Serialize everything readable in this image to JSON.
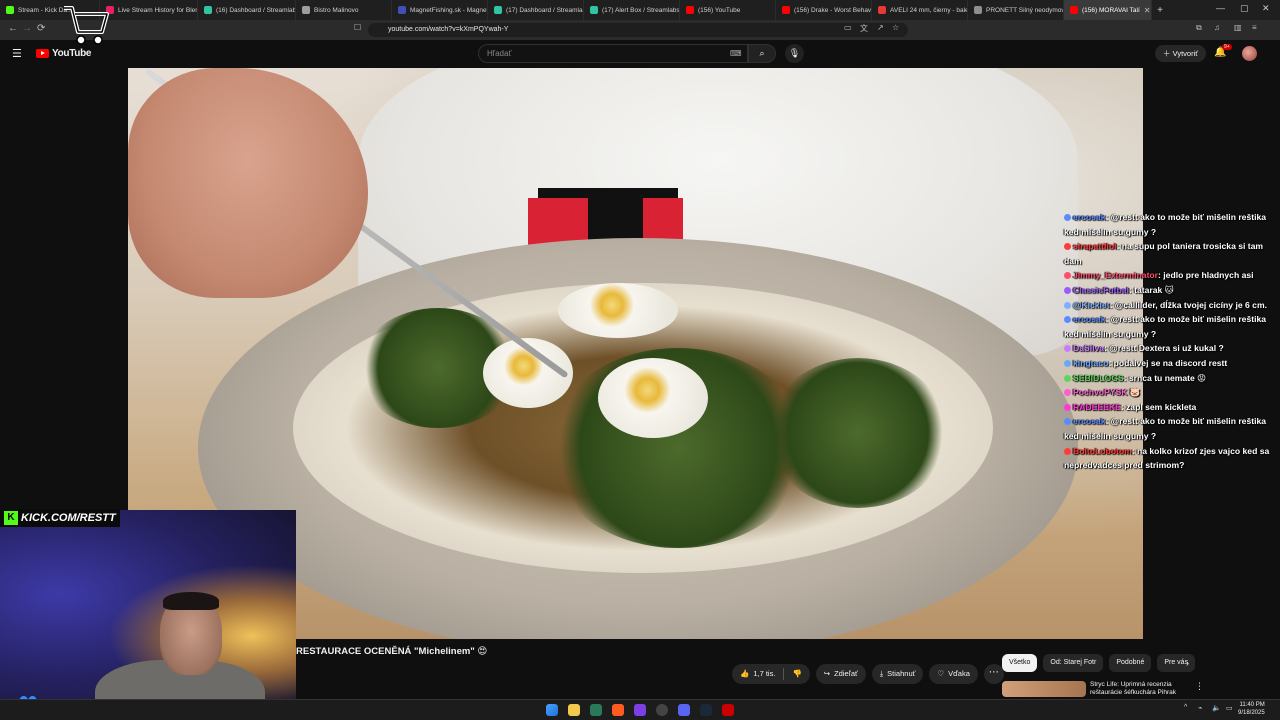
{
  "browser": {
    "tabs": [
      {
        "label": "Stream - Kick Da...",
        "color": "#53fc18"
      },
      {
        "label": "Live Stream History for Bler",
        "color": "#e91e63"
      },
      {
        "label": "(16) Dashboard / Streamlabs",
        "color": "#31c3a2"
      },
      {
        "label": "Bistro Malinovo",
        "color": "#9e9e9e"
      },
      {
        "label": "MagnetFishing.sk - Magnet",
        "color": "#3f51b5"
      },
      {
        "label": "(17) Dashboard / Streamlabs",
        "color": "#31c3a2"
      },
      {
        "label": "(17) Alert Box / Streamlabs",
        "color": "#31c3a2"
      },
      {
        "label": "(156) YouTube",
        "color": "#ff0000"
      },
      {
        "label": "(156) Drake - Worst Behav",
        "color": "#ff0000"
      },
      {
        "label": "AVELI 24 mm, čierny - balen",
        "color": "#e53935"
      },
      {
        "label": "PRONETT Silný neodymový",
        "color": "#8e8e8e"
      },
      {
        "label": "(156) MORAVAI Talí",
        "color": "#ff0000",
        "active": true
      }
    ],
    "new_tab": "+",
    "address": "youtube.com/watch?v=kXmPQYwah-Y"
  },
  "youtube": {
    "logo_text": "YouTube",
    "search_placeholder": "Hľadať",
    "create_label": "Vytvoriť",
    "notif_count": "9+"
  },
  "chat": [
    {
      "user": "ercosak",
      "color": "#5b8cff",
      "text": ": @restt ako to može biť mišelin reštika ked mišelin su gumy ?"
    },
    {
      "user": "sirapattilol",
      "color": "#ff3b3b",
      "text": ": na supu pol taniera trosicka si tam dam"
    },
    {
      "user": "Jimmy_Exterminator",
      "color": "#ff4d6d",
      "text": ": jedlo pre hladnych asi"
    },
    {
      "user": "ClassicFutbal",
      "color": "#9b5cff",
      "text": ": tatarak 🐱"
    },
    {
      "user": "@Kicklet",
      "color": "#7fb0ff",
      "text": ": @callilder, dĺžka tvojej cicíny je 6 cm."
    },
    {
      "user": "ercosak",
      "color": "#5b8cff",
      "text": ": @restt ako to može biť mišelin reštika ked mišelin su gumy ?"
    },
    {
      "user": "DaSilva",
      "color": "#c77dff",
      "text": ": @restt Dextera si už kukal ?"
    },
    {
      "user": "kingtaco",
      "color": "#6aa7ff",
      "text": ": podaivej se na discord restt"
    },
    {
      "user": "SEBIDLOGS",
      "color": "#5cd65c",
      "text": ": srnca tu nemate 😡"
    },
    {
      "user": "PochvoPYSK",
      "color": "#ff5fd1",
      "text": " 🐷"
    },
    {
      "user": "RADEEEKE",
      "color": "#ff3bd4",
      "text": ": zapl sem kickleta"
    },
    {
      "user": "ercosak",
      "color": "#5b8cff",
      "text": ": @restt ako to može biť mišelin reštika ked mišelin su gumy ?"
    },
    {
      "user": "BoltoLobotom",
      "color": "#ff3b3b",
      "text": ": na kolko krizof zjes vajco ked sa nepredvadces pred strimom?"
    }
  ],
  "webcam": {
    "kick_url": "KICK.COM/RESTT",
    "kick_letter": "K"
  },
  "video": {
    "title": "RESTAURACE OCENĚNÁ \"Michelinem\" 😍",
    "likes": "1,7 tis.",
    "share": "Zdieľať",
    "download": "Stiahnuť",
    "thanks": "Vďaka",
    "more": "⋯"
  },
  "chips": [
    "Všetko",
    "Od: Starej Fotr",
    "Podobné",
    "Pre vás"
  ],
  "recommendation": {
    "title": "Stryc Life: Úprimná recenzia reštaurácie šéfkuchára Pihrak"
  },
  "taskbar": {
    "time": "11:40 PM",
    "date": "9/18/2025"
  },
  "colors": {
    "youtube_red": "#ff0000",
    "kick_green": "#53fc18",
    "page_bg": "#0f0f0f"
  }
}
